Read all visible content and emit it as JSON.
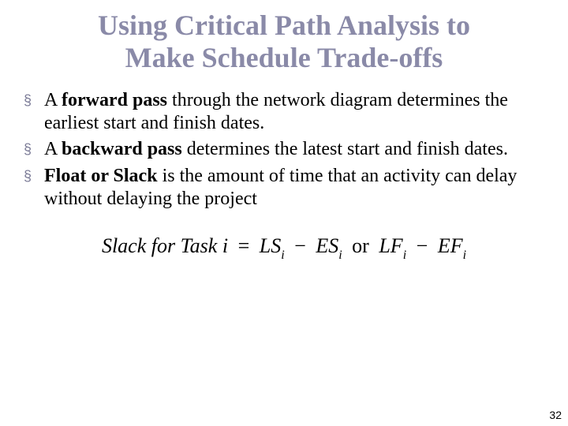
{
  "title_line1": "Using Critical Path Analysis to",
  "title_line2": "Make Schedule Trade-offs",
  "bullets": [
    {
      "bold": "forward pass",
      "pre": "A ",
      "post": " through the network diagram determines the earliest start and finish dates."
    },
    {
      "bold": "backward pass",
      "pre": "A ",
      "post": " determines the latest start and finish dates."
    },
    {
      "bold": "Float or Slack",
      "pre": "",
      "post": " is the amount of time that an activity can delay without delaying the project"
    }
  ],
  "formula": {
    "lhs": "Slack for Task i",
    "eq": "=",
    "t1": "LS",
    "s1": "i",
    "minus": "−",
    "t2": "ES",
    "s2": "i",
    "or": "or",
    "t3": "LF",
    "s3": "i",
    "t4": "EF",
    "s4": "i"
  },
  "page": "32"
}
